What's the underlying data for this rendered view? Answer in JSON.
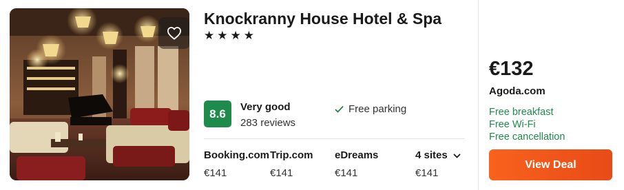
{
  "hotel": {
    "name": "Knockranny House Hotel & Spa",
    "stars": "★★★★",
    "rating_score": "8.6",
    "rating_label": "Very good",
    "reviews": "283 reviews",
    "amenity": "Free parking"
  },
  "sites": [
    {
      "name": "Booking.com",
      "price": "€141"
    },
    {
      "name": "Trip.com",
      "price": "€141"
    },
    {
      "name": "eDreams",
      "price": "€141"
    },
    {
      "name": "4 sites",
      "price": "€141"
    }
  ],
  "deal": {
    "price": "€132",
    "provider": "Agoda.com",
    "perks": [
      "Free breakfast",
      "Free Wi-Fi",
      "Free cancellation"
    ],
    "button_label": "View Deal"
  },
  "colors": {
    "rating_green": "#1e8a4b",
    "deal_orange": "#f8621d",
    "perk_green": "#1e8a4b"
  },
  "icons": {
    "favorite": "heart-icon",
    "amenity": "check-icon",
    "more_sites": "chevron-down-icon"
  }
}
